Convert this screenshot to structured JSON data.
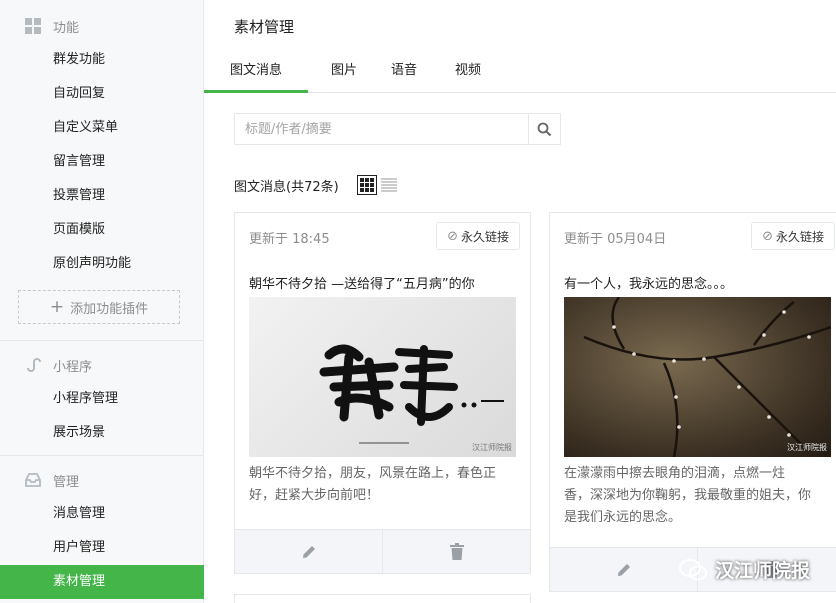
{
  "sidebar": {
    "functions": {
      "header": "功能",
      "items": [
        "群发功能",
        "自动回复",
        "自定义菜单",
        "留言管理",
        "投票管理",
        "页面模版",
        "原创声明功能"
      ],
      "add_plugin": "添加功能插件"
    },
    "miniprogram": {
      "header": "小程序",
      "items": [
        "小程序管理",
        "展示场景"
      ]
    },
    "manage": {
      "header": "管理",
      "items": [
        "消息管理",
        "用户管理",
        "素材管理"
      ]
    }
  },
  "main": {
    "title": "素材管理",
    "tabs": [
      "图文消息",
      "图片",
      "语音",
      "视频"
    ],
    "active_tab": "图文消息",
    "search": {
      "placeholder": "标题/作者/摘要",
      "value": ""
    },
    "count_label": "图文消息(共72条)",
    "cards": [
      {
        "updated": "更新于 18:45",
        "link_label": "永久链接",
        "title": "朝华不待夕拾 —送给得了“五月病”的你",
        "desc_lines": [
          "朝华不待夕拾，朋友，风景在路上，春色正",
          "好，赶紧大步向前吧！"
        ],
        "cover_caption": "汉江师院报"
      },
      {
        "updated": "更新于 05月04日",
        "link_label": "永久链接",
        "title": "有一个人，我永远的思念。。。",
        "desc_lines": [
          "在濛濛雨中擦去眼角的泪滴，点燃一炷",
          "香，深深地为你鞠躬，我最敬重的姐夫，你",
          "是我们永远的思念。"
        ],
        "cover_caption": "汉江师院报"
      }
    ]
  },
  "watermark": "汉江师院报",
  "colors": {
    "accent": "#44b549",
    "sidebar_bg": "#f6f8f9",
    "border": "#e4e8eb"
  }
}
